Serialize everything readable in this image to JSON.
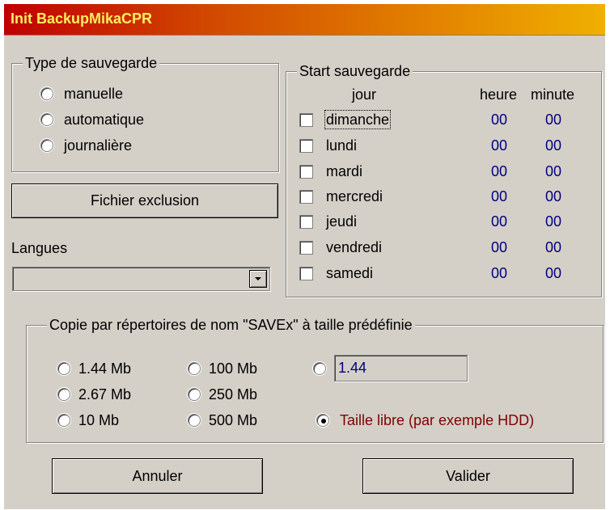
{
  "window": {
    "title": "Init  BackupMikaCPR"
  },
  "type_group": {
    "legend": "Type de sauvegarde",
    "options": [
      {
        "label": "manuelle",
        "selected": false
      },
      {
        "label": "automatique",
        "selected": false
      },
      {
        "label": "journalière",
        "selected": false
      }
    ]
  },
  "exclusion_button": {
    "label": "Fichier exclusion"
  },
  "languages": {
    "label": "Langues",
    "value": ""
  },
  "start_group": {
    "legend": "Start sauvegarde",
    "headers": {
      "day": "jour",
      "hour": "heure",
      "minute": "minute"
    },
    "rows": [
      {
        "day": "dimanche",
        "checked": false,
        "hour": "00",
        "minute": "00"
      },
      {
        "day": "lundi",
        "checked": false,
        "hour": "00",
        "minute": "00"
      },
      {
        "day": "mardi",
        "checked": false,
        "hour": "00",
        "minute": "00"
      },
      {
        "day": "mercredi",
        "checked": false,
        "hour": "00",
        "minute": "00"
      },
      {
        "day": "jeudi",
        "checked": false,
        "hour": "00",
        "minute": "00"
      },
      {
        "day": "vendredi",
        "checked": false,
        "hour": "00",
        "minute": "00"
      },
      {
        "day": "samedi",
        "checked": false,
        "hour": "00",
        "minute": "00"
      }
    ]
  },
  "copy_group": {
    "legend": "Copie par répertoires de nom \"SAVEx\" à  taille prédéfinie",
    "sizes": [
      {
        "label": "1.44 Mb",
        "selected": false
      },
      {
        "label": "2.67 Mb",
        "selected": false
      },
      {
        "label": "10 Mb",
        "selected": false
      },
      {
        "label": "100 Mb",
        "selected": false
      },
      {
        "label": "250 Mb",
        "selected": false
      },
      {
        "label": "500 Mb",
        "selected": false
      }
    ],
    "custom_value": "1.44",
    "custom_selected": false,
    "free_label": "Taille libre (par exemple HDD)",
    "free_selected": true,
    "free_color": "#800000"
  },
  "buttons": {
    "cancel": "Annuler",
    "ok": "Valider"
  },
  "colors": {
    "dialog_bg": "#d4d0c8",
    "value_text": "#000080",
    "title_text": "#ffef60"
  }
}
